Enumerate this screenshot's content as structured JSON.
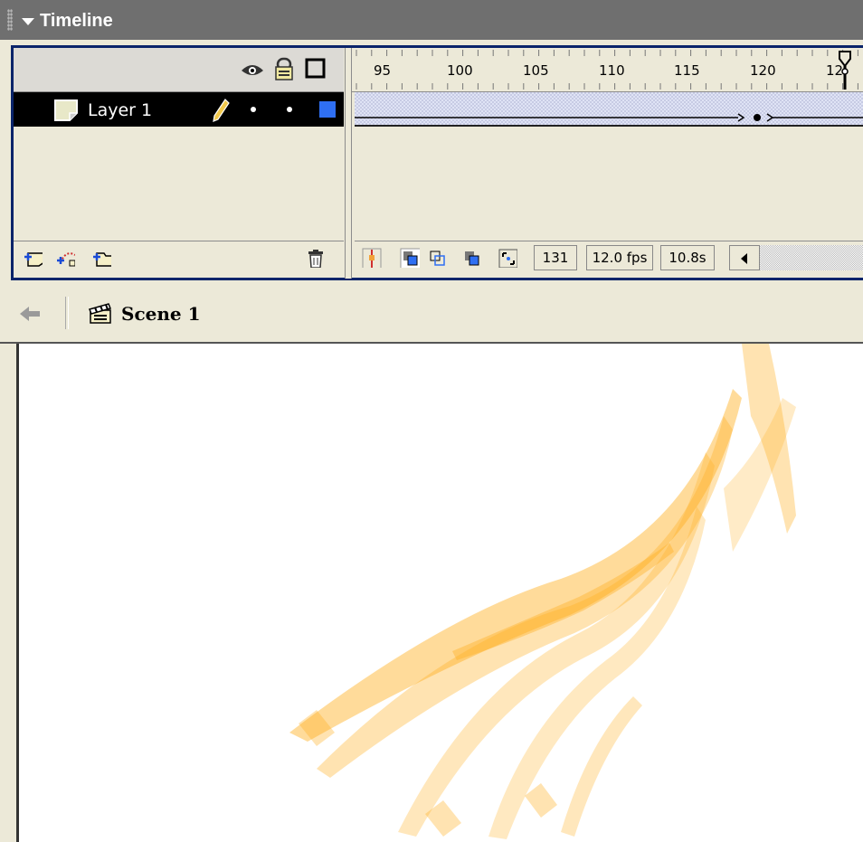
{
  "panel": {
    "title": "Timeline"
  },
  "layers_header": {
    "icons": [
      "eye-icon",
      "lock-icon",
      "outline-icon"
    ]
  },
  "ruler": {
    "ticks": [
      "95",
      "100",
      "105",
      "110",
      "115",
      "120",
      "12"
    ]
  },
  "layer": {
    "name": "Layer 1",
    "outline_color": "#2f6ff2"
  },
  "layer_tools": {
    "icons": [
      "insert-layer-icon",
      "add-motion-guide-icon",
      "insert-layer-folder-icon",
      "delete-layer-icon"
    ]
  },
  "frame_status": {
    "current_frame": "131",
    "frame_rate": "12.0 fps",
    "elapsed_time": "10.8s"
  },
  "scene": {
    "name": "Scene 1"
  },
  "colors": {
    "title_bar": "#6f6f6f",
    "panel_border": "#0a246a",
    "stage_art": "#ffb020"
  }
}
